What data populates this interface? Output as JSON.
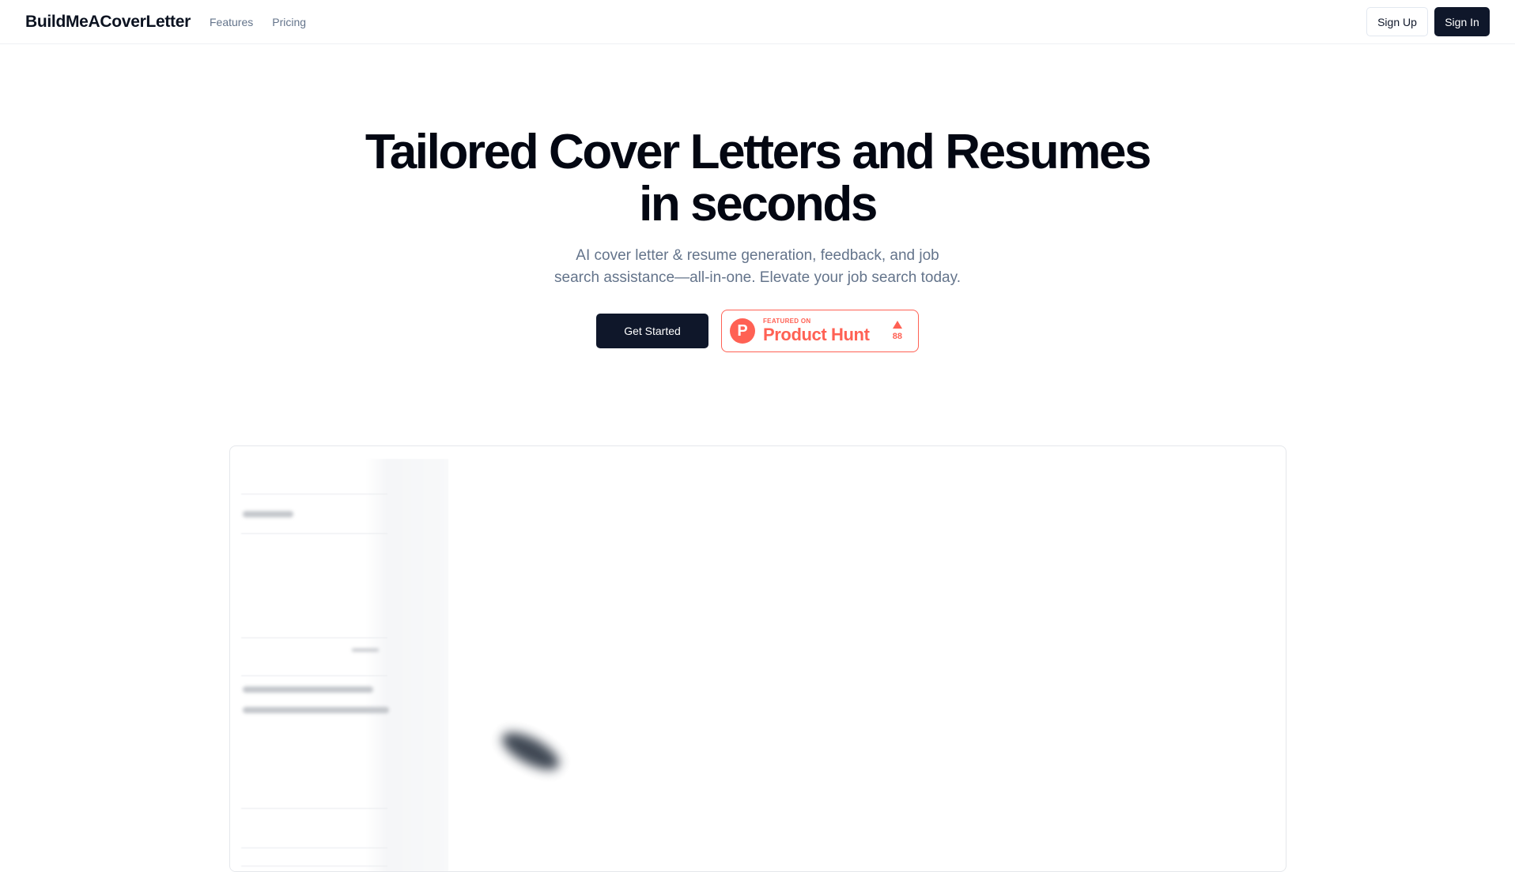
{
  "header": {
    "brand": "BuildMeACoverLetter",
    "nav": [
      {
        "label": "Features"
      },
      {
        "label": "Pricing"
      }
    ],
    "sign_up_label": "Sign Up",
    "sign_in_label": "Sign In"
  },
  "hero": {
    "title_line1": "Tailored Cover Letters and Resumes",
    "title_line2": "in seconds",
    "subtitle_line1": "AI cover letter & resume generation, feedback, and job",
    "subtitle_line2": "search assistance—all-in-one. Elevate your job search today.",
    "cta_label": "Get Started"
  },
  "product_hunt": {
    "logo_letter": "P",
    "kicker": "FEATURED ON",
    "name": "Product Hunt",
    "votes": "88",
    "color": "#ff6154"
  },
  "colors": {
    "primary_dark": "#0f172a",
    "muted_text": "#64748b",
    "border": "#e2e8f0"
  }
}
